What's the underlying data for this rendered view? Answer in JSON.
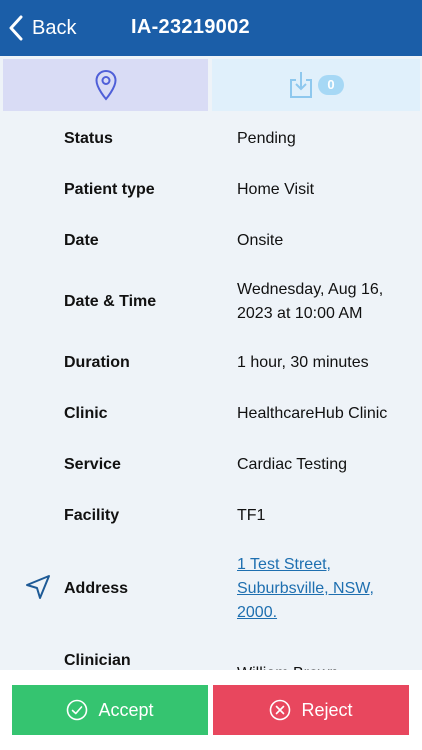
{
  "header": {
    "back_label": "Back",
    "title": "IA-23219002",
    "background_color": "#1b5ea8"
  },
  "tabs": [
    {
      "icon": "location-pin-icon",
      "active": true
    },
    {
      "icon": "download-icon",
      "badge": "0"
    }
  ],
  "details": [
    {
      "label": "Status",
      "value": "Pending"
    },
    {
      "label": "Patient type",
      "value": "Home Visit"
    },
    {
      "label": "Date",
      "value": "Onsite"
    },
    {
      "label": "Date & Time",
      "value": "Wednesday, Aug 16, 2023 at 10:00 AM"
    },
    {
      "label": "Duration",
      "value": "1 hour, 30 minutes"
    },
    {
      "label": "Clinic",
      "value": "HealthcareHub Clinic"
    },
    {
      "label": "Service",
      "value": "Cardiac Testing"
    },
    {
      "label": "Facility",
      "value": "TF1"
    },
    {
      "label": "Address",
      "value": "1 Test Street, Suburbsville, NSW, 2000.",
      "icon": "navigation-arrow-icon"
    },
    {
      "label": "Clinician",
      "value": "William Brown"
    }
  ],
  "actions": {
    "accept_label": "Accept",
    "reject_label": "Reject",
    "accept_color": "#35c470",
    "reject_color": "#e8475e"
  }
}
